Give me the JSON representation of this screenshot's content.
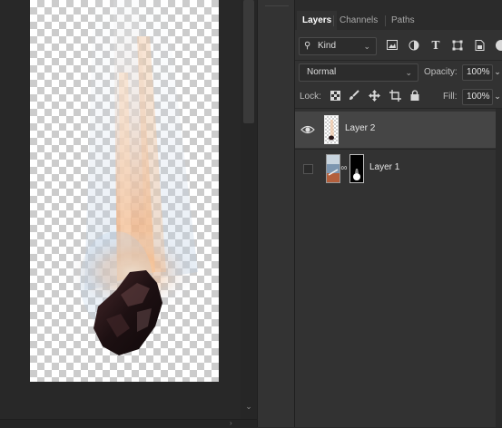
{
  "panel": {
    "tabs": [
      "Layers",
      "Channels",
      "Paths"
    ],
    "active_tab": "Layers",
    "filter": {
      "kind_label": "Kind",
      "search_icon": "search-icon"
    },
    "blend_mode": "Normal",
    "opacity_label": "Opacity:",
    "opacity_value": "100%",
    "lock_label": "Lock:",
    "fill_label": "Fill:",
    "fill_value": "100%",
    "layers": [
      {
        "name": "Layer 2",
        "visible": true,
        "selected": true
      },
      {
        "name": "Layer 1",
        "visible": false,
        "selected": false,
        "has_mask": true
      }
    ]
  },
  "colors": {
    "app_bg": "#282828",
    "panel_bg": "#323232",
    "selected_layer": "#454545",
    "text": "#d6d6d6"
  }
}
